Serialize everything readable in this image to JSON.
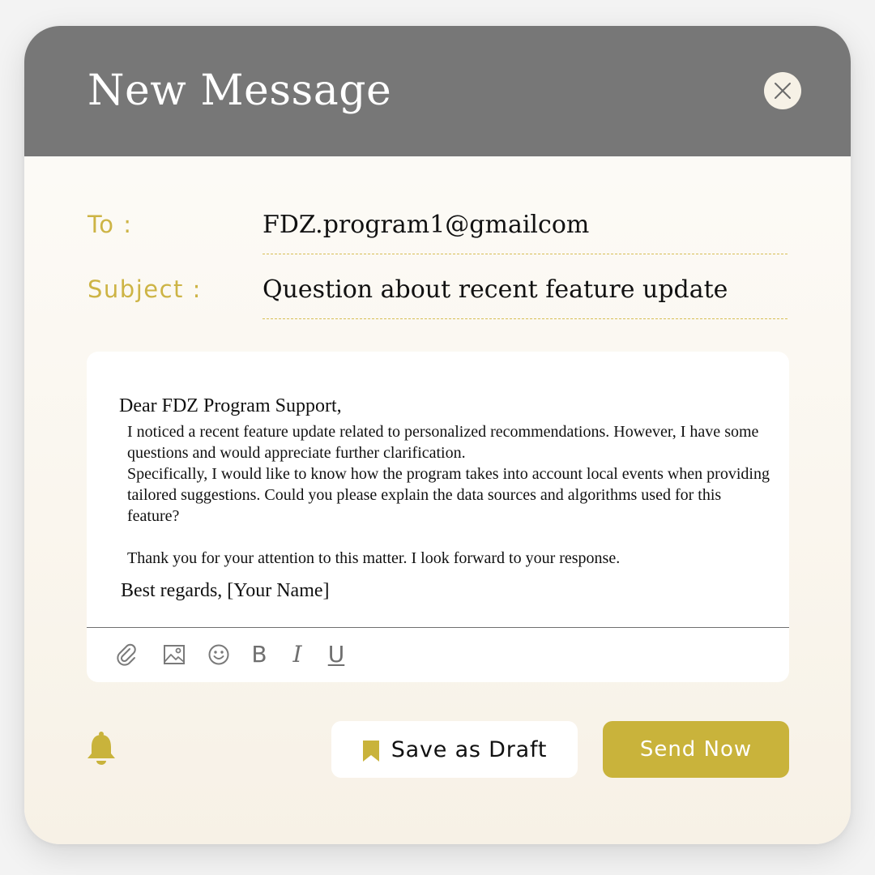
{
  "window": {
    "title": "New Message",
    "close_icon": "close-icon"
  },
  "fields": {
    "to_label": "To :",
    "to_value": "FDZ.program1@gmailcom",
    "subject_label": "Subject :",
    "subject_value": "Question about recent feature update"
  },
  "message": {
    "greeting": "Dear FDZ Program Support,",
    "paragraph_1": " I noticed a recent feature update related to personalized recommendations. However, I have some questions and would appreciate further clarification.",
    "paragraph_2": "Specifically, I would like to know how the program takes into account local events when providing tailored suggestions. Could you please explain the data sources and algorithms used for this feature?",
    "paragraph_3": "Thank you for your attention to this matter. I look forward to your response.",
    "signoff": "Best regards, [Your Name]"
  },
  "toolbar": {
    "icons": [
      "paperclip-icon",
      "image-icon",
      "emoji-icon"
    ],
    "bold_glyph": "B",
    "italic_glyph": "I",
    "underline_glyph": "U"
  },
  "actions": {
    "notification_icon": "bell-icon",
    "draft_icon": "bookmark-icon",
    "draft_label": "Save as Draft",
    "send_label": "Send Now"
  },
  "colors": {
    "header": "#777777",
    "accent": "#c9b33b",
    "label": "#cdb445",
    "background": "#faf6ee"
  }
}
